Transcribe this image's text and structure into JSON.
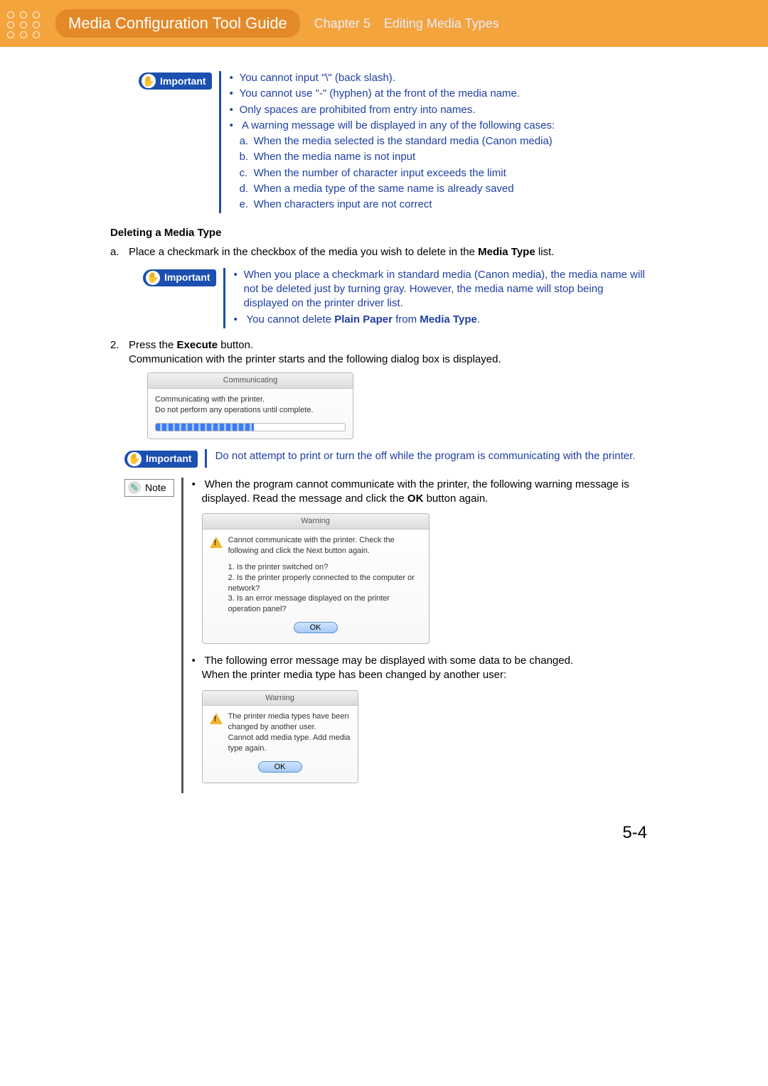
{
  "header": {
    "title": "Media Configuration Tool Guide",
    "chapter_label": "Chapter 5",
    "chapter_name": "Editing Media Types"
  },
  "labels": {
    "important": "Important",
    "note": "Note"
  },
  "important1": {
    "b1": "You cannot input \"\\\" (back slash).",
    "b2": "You cannot use \"-\" (hyphen) at the front of the media name.",
    "b3": "Only spaces are prohibited from entry into names.",
    "b4_intro": "A warning message will be displayed in any of the following cases:",
    "a": "When the media selected is the standard media (Canon media)",
    "b": "When the media name is not input",
    "c": "When the number of character input exceeds the limit",
    "d": "When a media type of the same name is already saved",
    "e": "When characters input are not correct"
  },
  "section_heading": "Deleting a Media Type",
  "step_a_pre": "Place a checkmark in the checkbox of the media you wish to delete in the ",
  "step_a_bold": "Media Type",
  "step_a_post": " list.",
  "important2": {
    "b1": "When you place a checkmark in standard media (Canon media), the media name will not be deleted just by turning gray. However, the media name will stop being displayed on the printer driver list.",
    "b2_pre": "You cannot delete ",
    "b2_bold1": "Plain Paper",
    "b2_mid": " from ",
    "b2_bold2": "Media Type",
    "b2_post": "."
  },
  "step2_pre": "Press the ",
  "step2_bold": "Execute",
  "step2_post": " button.",
  "step2_line2": "Communication with the printer starts and the following dialog box is displayed.",
  "dlg_comm": {
    "title": "Communicating",
    "line1": "Communicating with the printer.",
    "line2": "Do not perform any operations until complete."
  },
  "important3": "Do not attempt to print or turn the off while the program is communicating with the printer.",
  "note1": {
    "b1_pre": "When the program cannot communicate with the printer, the following warning message is displayed. Read the message and click the ",
    "b1_bold": "OK",
    "b1_post": " button again.",
    "dlg": {
      "title": "Warning",
      "msg": "Cannot communicate with the printer. Check the following and click the Next button again.",
      "q1": "1. Is the printer switched on?",
      "q2": "2. Is the printer properly connected to the computer or network?",
      "q3": "3. Is an error message displayed on the printer operation panel?",
      "ok": "OK"
    },
    "b2_line1": "The following error message may be displayed with some data to be changed.",
    "b2_line2": "When the printer media type has been changed by another user:",
    "dlg2": {
      "title": "Warning",
      "msg": "The printer media types have been changed by another user.\nCannot add media type. Add media type again.",
      "ok": "OK"
    }
  },
  "page_number": "5-4"
}
